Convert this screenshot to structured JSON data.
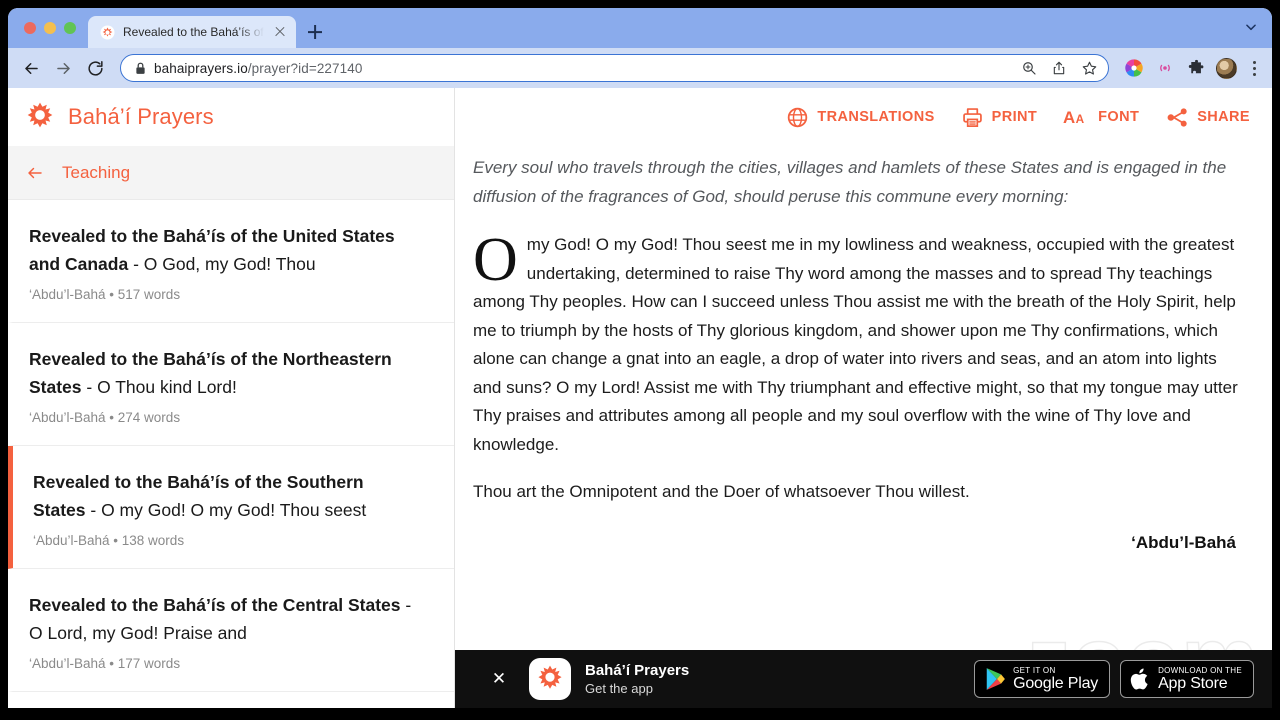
{
  "browser": {
    "tab": {
      "title": "Revealed to the Bahá’ís of the",
      "favicon_name": "bahai-sun-favicon",
      "close_label": "×"
    },
    "new_tab_label": "+",
    "url": "bahaiprayers.io",
    "url_path": "/prayer?id=227140",
    "nav": {
      "back": "Back",
      "forward": "Forward",
      "reload": "Reload"
    },
    "omnibox_icons": [
      "zoom-icon",
      "share-icon",
      "bookmark-star-icon"
    ],
    "extension_icons": [
      "color-wheel-extension-icon",
      "cast-icon",
      "puzzle-extension-icon",
      "profile-avatar",
      "kebab-menu-icon"
    ]
  },
  "sidebar": {
    "brand": "Bahá’í Prayers",
    "back_label": "Teaching",
    "items": [
      {
        "title_bold": "Revealed to the Bahá’ís of the United States and Canada",
        "title_rest": " - O God, my God! Thou",
        "meta": "‘Abdu’l-Bahá • 517 words",
        "selected": false
      },
      {
        "title_bold": "Revealed to the Bahá’ís of the Northeastern States",
        "title_rest": " - O Thou kind Lord!",
        "meta": "‘Abdu’l-Bahá • 274 words",
        "selected": false
      },
      {
        "title_bold": "Revealed to the Bahá’ís of the Southern States",
        "title_rest": " - O my God! O my God! Thou seest",
        "meta": "‘Abdu’l-Bahá • 138 words",
        "selected": true
      },
      {
        "title_bold": "Revealed to the Bahá’ís of the Central States",
        "title_rest": " - O Lord, my God! Praise and",
        "meta": "‘Abdu’l-Bahá • 177 words",
        "selected": false
      }
    ]
  },
  "actions": [
    {
      "label": "TRANSLATIONS",
      "icon": "globe-icon"
    },
    {
      "label": "PRINT",
      "icon": "printer-icon"
    },
    {
      "label": "FONT",
      "icon": "font-size-icon"
    },
    {
      "label": "SHARE",
      "icon": "share-nodes-icon"
    }
  ],
  "article": {
    "intro": "Every soul who travels through the cities, villages and hamlets of these States and is engaged in the diffusion of the fragrances of God, should peruse this commune every morning:",
    "paragraphs": [
      "O my God! O my God! Thou seest me in my lowliness and weakness, occupied with the greatest undertaking, determined to raise Thy word among the masses and to spread Thy teachings among Thy peoples. How can I succeed unless Thou assist me with the breath of the Holy Spirit, help me to triumph by the hosts of Thy glorious kingdom, and shower upon me Thy confirmations, which alone can change a gnat into an eagle, a drop of water into rivers and seas, and an atom into lights and suns? O my Lord! Assist me with Thy triumphant and effective might, so that my tongue may utter Thy praises and attributes among all people and my soul overflow with the wine of Thy love and knowledge.",
      "Thou art the Omnipotent and the Doer of whatsoever Thou willest."
    ],
    "attribution": "‘Abdu’l-Bahá",
    "watermark": "zoom"
  },
  "app_banner": {
    "close_label": "✕",
    "title": "Bahá’í Prayers",
    "subtitle": "Get the app",
    "google_play": {
      "small": "GET IT ON",
      "big": "Google Play"
    },
    "app_store": {
      "small": "Download on the",
      "big": "App Store"
    }
  },
  "colors": {
    "accent": "#f4613f",
    "tabstrip": "#8aabec",
    "navbar": "#cfdcf5",
    "banner_bg": "#101010"
  }
}
